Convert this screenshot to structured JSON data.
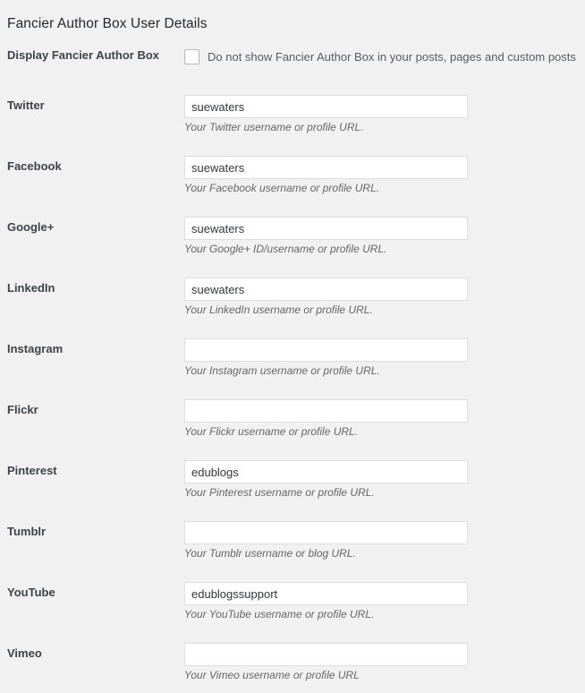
{
  "page": {
    "title": "Fancier Author Box User Details",
    "background_color": "#f1f1f1",
    "heading_color": "#23282d",
    "label_color": "#3c434a",
    "hint_color": "#666666",
    "input_border_color": "#dddddd",
    "input_background": "#ffffff",
    "checkbox_border_color": "#b4b9be"
  },
  "display_row": {
    "label": "Display Fancier Author Box",
    "checkbox_label": "Do not show Fancier Author Box in your posts, pages and custom posts",
    "checked": false
  },
  "fields": [
    {
      "label": "Twitter",
      "value": "suewaters",
      "placeholder": "",
      "hint": "Your Twitter username or profile URL."
    },
    {
      "label": "Facebook",
      "value": "suewaters",
      "placeholder": "",
      "hint": "Your Facebook username or profile URL."
    },
    {
      "label": "Google+",
      "value": "suewaters",
      "placeholder": "",
      "hint": "Your Google+ ID/username or profile URL."
    },
    {
      "label": "LinkedIn",
      "value": "suewaters",
      "placeholder": "",
      "hint": "Your LinkedIn username or profile URL."
    },
    {
      "label": "Instagram",
      "value": "",
      "placeholder": "",
      "hint": "Your Instagram username or profile URL."
    },
    {
      "label": "Flickr",
      "value": "",
      "placeholder": "",
      "hint": "Your Flickr username or profile URL."
    },
    {
      "label": "Pinterest",
      "value": "edublogs",
      "placeholder": "",
      "hint": "Your Pinterest username or profile URL."
    },
    {
      "label": "Tumblr",
      "value": "",
      "placeholder": "",
      "hint": "Your Tumblr username or blog URL."
    },
    {
      "label": "YouTube",
      "value": "edublogssupport",
      "placeholder": "",
      "hint": "Your YouTube username or profile URL."
    },
    {
      "label": "Vimeo",
      "value": "",
      "placeholder": "",
      "hint": "Your Vimeo username or profile URL"
    }
  ]
}
